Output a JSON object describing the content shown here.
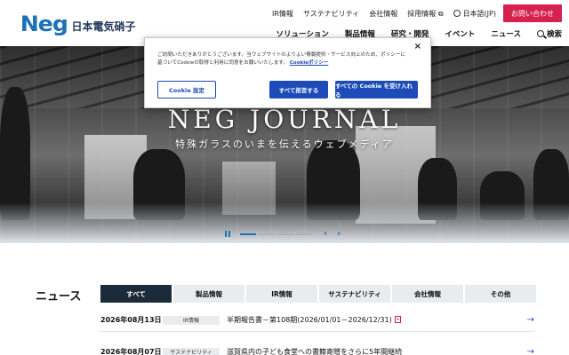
{
  "header": {
    "logo": "Neg",
    "company_name": "日本電気硝子",
    "utility_nav": [
      "IR情報",
      "サステナビリティ",
      "会社情報",
      "採用情報 ⧉"
    ],
    "language": "日本語(JP)",
    "contact_label": "お問い合わせ",
    "main_nav": [
      "ソリューション",
      "製品情報",
      "研究・開発",
      "イベント",
      "ニュース"
    ],
    "search_label": "検索"
  },
  "hero": {
    "title": "NEG JOURNAL",
    "subtitle": "特殊ガラスのいまを伝えるウェブメディア",
    "prev_arrow": "‹",
    "next_arrow": "›",
    "slide_count": 4,
    "active_slide": 1
  },
  "cookie": {
    "text": "ご訪問いただきありがとうございます。当ウェブサイトのよりよい情報提供・サービス向上のため、ポリシーに基づいてCookieの取得と利用に同意をお願いいたします。",
    "policy_link": "Cookieポリシー",
    "close": "×",
    "settings_label": "Cookie 設定",
    "reject_label": "すべて拒否する",
    "accept_label": "すべての Cookie を受け入れる"
  },
  "news": {
    "heading": "ニュース",
    "tabs": [
      "すべて",
      "製品情報",
      "IR情報",
      "サステナビリティ",
      "会社情報",
      "その他"
    ],
    "items": [
      {
        "date": "2026年08月13日",
        "category": "IR情報",
        "title": "半期報告書－第108期(2026/01/01－2026/12/31)",
        "arrow": "→"
      },
      {
        "date": "2026年08月07日",
        "category": "サステナビリティ",
        "title": "滋賀県内の子ども食堂への書籍寄贈をさらに5年間継続",
        "arrow": "→"
      }
    ]
  }
}
